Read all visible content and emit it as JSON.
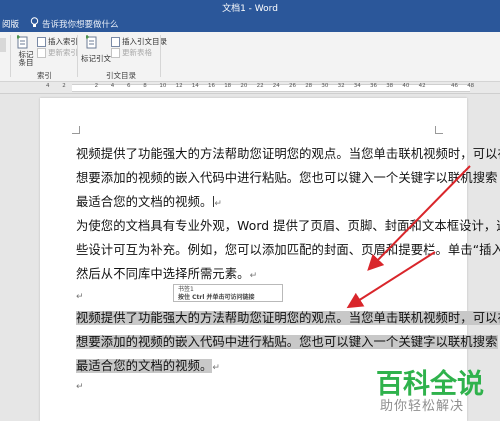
{
  "window": {
    "title": "文档1  -  Word"
  },
  "tellbar": {
    "left_tab": "阅版",
    "placeholder": "告诉我你想要做什么"
  },
  "ribbon": {
    "group_index": {
      "mark_entry": "标记\n条目",
      "insert_index": "插入索引",
      "update_index": "更新索引",
      "label": "索引"
    },
    "group_toa": {
      "mark_citation": "标记引文",
      "insert_toa": "插入引文目录",
      "update_toa": "更新表格",
      "label": "引文目录"
    }
  },
  "ruler": {
    "numbers": [
      "4",
      "2",
      "",
      "2",
      "4",
      "6",
      "8",
      "10",
      "12",
      "14",
      "16",
      "18",
      "20",
      "22",
      "24",
      "26",
      "28",
      "30",
      "32",
      "34",
      "36",
      "38",
      "40",
      "42",
      "",
      "46",
      "48"
    ]
  },
  "document": {
    "para1": [
      "视频提供了功能强大的方法帮助您证明您的观点。当您单击联机视频时，可以在",
      "想要添加的视频的嵌入代码中进行粘贴。您也可以键入一个关键字以联机搜索",
      "最适合您的文档的视频。"
    ],
    "para2": [
      "为使您的文档具有专业外观，Word 提供了页眉、页脚、封面和文本框设计，这",
      "些设计可互为补充。例如，您可以添加匹配的封面、页眉和提要栏。单击“插入”，",
      "然后从不同库中选择所需元素。"
    ],
    "tooltip": {
      "line1": "书签1",
      "line2": "按住 Ctrl 并单击可访问链接"
    },
    "para3": [
      "视频提供了功能强大的方法帮助您证明您的观点。当您单击联机视频时，可以在",
      "想要添加的视频的嵌入代码中进行粘贴。您也可以键入一个关键字以联机搜索",
      "最适合您的文档的视频。"
    ],
    "para_mark": "↵",
    "arrow_color": "#d9262b",
    "highlight_color": "#c8c8c8"
  },
  "watermark": {
    "title": "百科全说",
    "subtitle": "助你轻松解决"
  }
}
